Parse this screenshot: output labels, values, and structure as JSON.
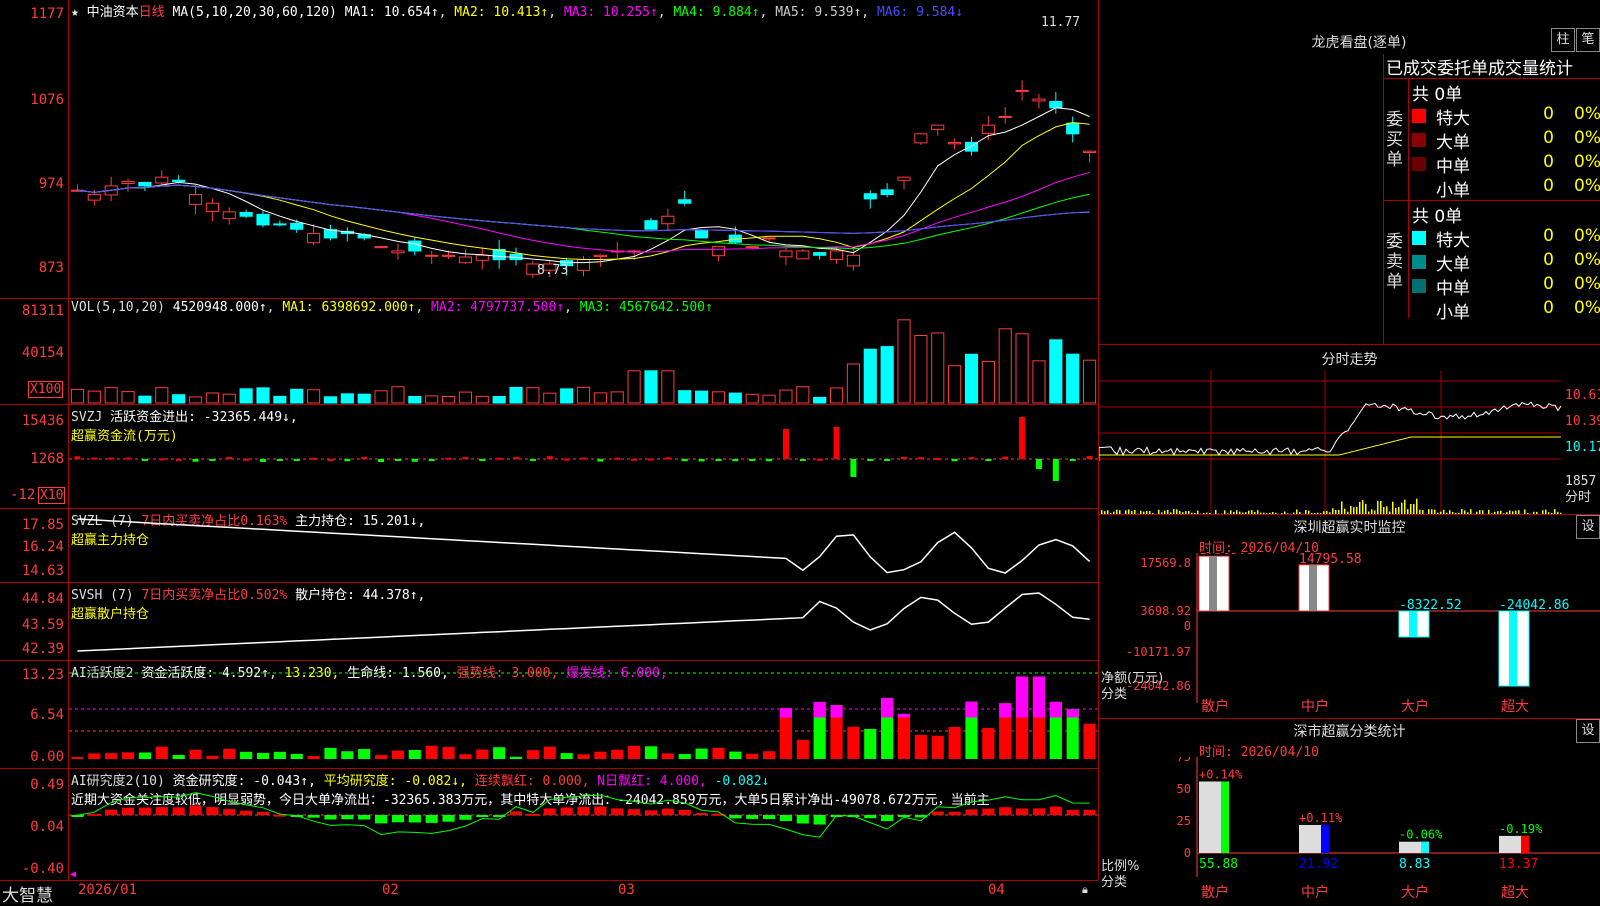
{
  "stock": {
    "name": "中油资本",
    "period": "日线",
    "ma_params": "MA(5,10,20,30,60,120)",
    "ma": [
      {
        "label": "MA1: 10.654↑",
        "color": "#ffffff"
      },
      {
        "label": "MA2: 10.413↑",
        "color": "#ffff00"
      },
      {
        "label": "MA3: 10.255↑",
        "color": "#ff00ff"
      },
      {
        "label": "MA4: 9.884↑",
        "color": "#00ff00"
      },
      {
        "label": "MA5: 9.539↑",
        "color": "#cccccc"
      },
      {
        "label": "MA6: 9.584↓",
        "color": "#4a4aff"
      }
    ],
    "price_axis": [
      "1177",
      "1076",
      "974",
      "873"
    ],
    "high_label": "11.77",
    "low_label": "8.73"
  },
  "vol": {
    "header": "VOL(5,10,20)",
    "value": "4520948.000↑",
    "ma1": "MA1: 6398692.000↑",
    "ma2": "MA2: 4797737.500↑",
    "ma3": "MA3: 4567642.500↑",
    "axis": [
      "81311",
      "40154"
    ],
    "unit": "X100"
  },
  "svzj": {
    "header": "SVZJ",
    "label": "活跃资金进出: -32365.449↓,",
    "sub": "超赢资金流(万元)",
    "axis": [
      "15436",
      "1268",
      "-12"
    ],
    "unit": "X10"
  },
  "svzl": {
    "header": "SVZL (7)",
    "label1": "7日内买卖净占比0.163%",
    "label2": "主力持仓: 15.201↓,",
    "sub": "超赢主力持仓",
    "axis": [
      "17.85",
      "16.24",
      "14.63"
    ]
  },
  "svsh": {
    "header": "SVSH (7)",
    "label1": "7日内买卖净占比0.502%",
    "label2": "散户持仓: 44.378↑,",
    "sub": "超赢散户持仓",
    "axis": [
      "44.84",
      "43.59",
      "42.39"
    ]
  },
  "ai_active": {
    "header": "AI活跃度2",
    "a": "资金活跃度: 4.592↑",
    "b": "13.230,",
    "c": "生命线: 1.560,",
    "d": "强势线: 3.000,",
    "e": "爆发线: 6.000,",
    "axis": [
      "13.23",
      "6.54",
      "0.00"
    ]
  },
  "ai_research": {
    "header": "AI研究度2(10)",
    "a": "资金研究度: -0.043↑,",
    "b": "平均研究度: -0.082↓,",
    "c": "连续飘红: 0.000,",
    "d": "N日飘红: 4.000,",
    "e": "-0.082↓",
    "summary": "近期大资金关注度较低，明显弱势，今日大单净流出：-32365.383万元，其中特大单净流出：-24042.859万元，大单5日累计净出-49078.672万元，当前主",
    "axis": [
      "0.49",
      "0.04",
      "-0.40"
    ]
  },
  "xaxis": [
    "2026/01",
    "02",
    "03",
    "04"
  ],
  "logo": "大智慧",
  "lhb": {
    "title": "龙虎看盘(逐单)",
    "btn1": "柱",
    "btn2": "笔",
    "header": "已成交委托单成交量统计",
    "buy_side": "委买单",
    "sell_side": "委卖单",
    "buy_total": "共 0单",
    "sell_total": "共 0单",
    "buy_rows": [
      {
        "label": "特大",
        "count": "0",
        "pct": "0%",
        "color": "#ff0000"
      },
      {
        "label": "大单",
        "count": "0",
        "pct": "0%",
        "color": "#8b0000"
      },
      {
        "label": "中单",
        "count": "0",
        "pct": "0%",
        "color": "#6b0000"
      },
      {
        "label": "小单",
        "count": "0",
        "pct": "0%",
        "color": ""
      }
    ],
    "sell_rows": [
      {
        "label": "特大",
        "count": "0",
        "pct": "0%",
        "color": "#00ffff"
      },
      {
        "label": "大单",
        "count": "0",
        "pct": "0%",
        "color": "#008b8b"
      },
      {
        "label": "中单",
        "count": "0",
        "pct": "0%",
        "color": "#007070"
      },
      {
        "label": "小单",
        "count": "0",
        "pct": "0%",
        "color": ""
      }
    ]
  },
  "intraday": {
    "title": "分时走势",
    "axis": [
      "10.61",
      "10.39",
      "10.17",
      "1857"
    ],
    "unit": "分时"
  },
  "monitor": {
    "title": "深圳超赢实时监控",
    "btn": "设",
    "time": "时间: 2026/04/10",
    "axis": [
      "17569.8",
      "3698.92",
      "0",
      "-10171.97",
      "-24042.86"
    ],
    "ylabel": "净额(万元)",
    "xlabel": "分类",
    "bars": [
      {
        "cat": "散户",
        "value": "17569.8"
      },
      {
        "cat": "中户",
        "value": "14795.58"
      },
      {
        "cat": "大户",
        "value": "-8322.52"
      },
      {
        "cat": "超大",
        "value": "-24042.86"
      }
    ]
  },
  "classify": {
    "title": "深市超赢分类统计",
    "btn": "设",
    "time": "时间: 2026/04/10",
    "axis": [
      "75",
      "50",
      "25",
      "0"
    ],
    "ylabel": "比例%",
    "xlabel": "分类",
    "bars": [
      {
        "cat": "散户",
        "value": "55.88",
        "delta": "+0.14%"
      },
      {
        "cat": "中户",
        "value": "21.92",
        "delta": "+0.11%"
      },
      {
        "cat": "大户",
        "value": "8.83",
        "delta": "-0.06%"
      },
      {
        "cat": "超大",
        "value": "13.37",
        "delta": "-0.19%"
      }
    ]
  }
}
